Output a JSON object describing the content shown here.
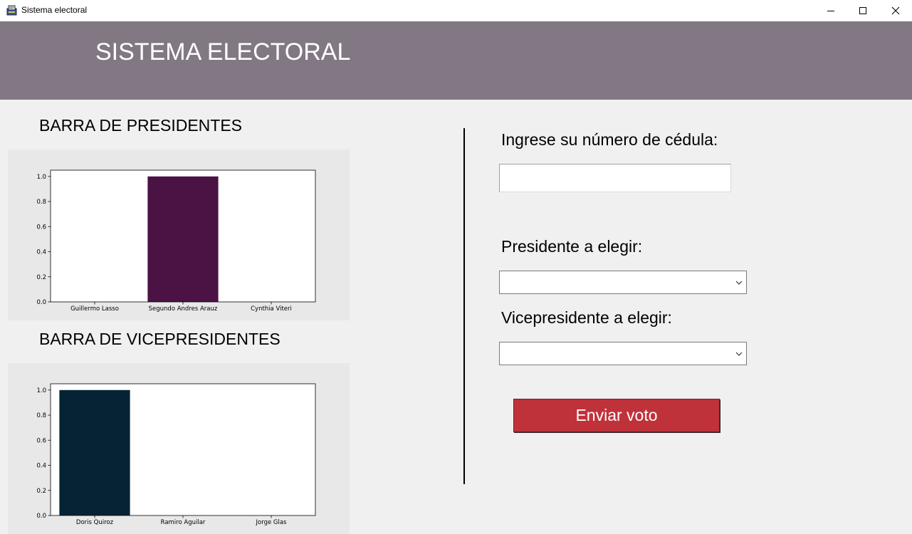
{
  "window": {
    "title": "Sistema electoral"
  },
  "header": {
    "title": "SISTEMA ELECTORAL"
  },
  "sections": {
    "presidents_title": "BARRA DE PRESIDENTES",
    "vicepresidents_title": "BARRA DE VICEPRESIDENTES"
  },
  "chart_data": [
    {
      "type": "bar",
      "categories": [
        "Guillermo Lasso",
        "Segundo Andres Arauz",
        "Cynthia Viteri"
      ],
      "values": [
        0,
        1.0,
        0
      ],
      "colors": [
        "#4b1244",
        "#4b1244",
        "#4b1244"
      ],
      "ylim": [
        0,
        1.05
      ],
      "yticks": [
        0.0,
        0.2,
        0.4,
        0.6,
        0.8,
        1.0
      ],
      "ytick_labels": [
        "0.0",
        "0.2",
        "0.4",
        "0.6",
        "0.8",
        "1.0"
      ],
      "grid": false
    },
    {
      "type": "bar",
      "categories": [
        "Doris Quiroz",
        "Ramiro Aguilar",
        "Jorge Glas"
      ],
      "values": [
        1.0,
        0,
        0
      ],
      "colors": [
        "#062335",
        "#062335",
        "#062335"
      ],
      "ylim": [
        0,
        1.05
      ],
      "yticks": [
        0.0,
        0.2,
        0.4,
        0.6,
        0.8,
        1.0
      ],
      "ytick_labels": [
        "0.0",
        "0.2",
        "0.4",
        "0.6",
        "0.8",
        "1.0"
      ],
      "grid": false
    }
  ],
  "form": {
    "cedula_label": "Ingrese su número de cédula:",
    "cedula_value": "",
    "president_label": "Presidente a elegir:",
    "president_value": "",
    "vicepresident_label": "Vicepresidente a elegir:",
    "vicepresident_value": "",
    "submit_label": "Enviar voto"
  },
  "colors": {
    "header_bg": "#817883",
    "submit_bg": "#c0323a",
    "president_bar": "#4b1244",
    "vicepresident_bar": "#062335"
  }
}
